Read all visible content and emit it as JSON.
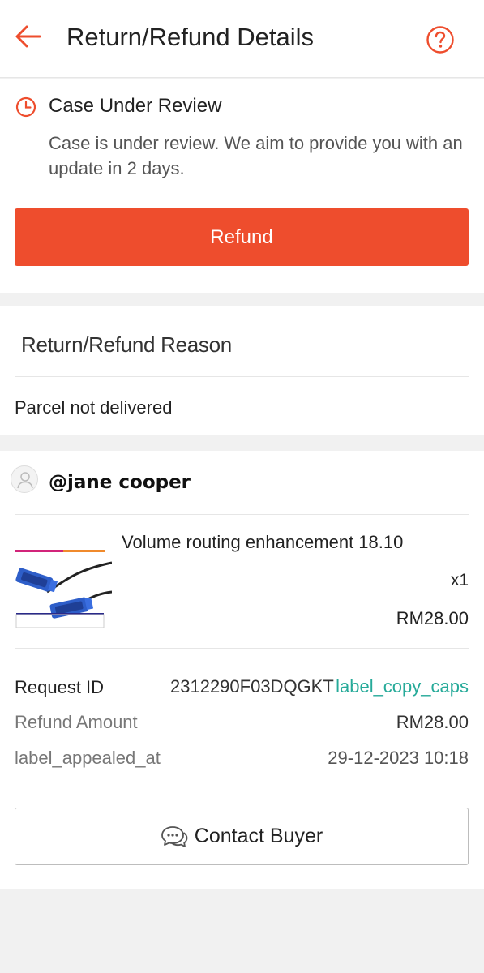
{
  "header": {
    "title": "Return/Refund Details",
    "back_icon": "arrow-left-icon",
    "help_icon": "question-circle-icon"
  },
  "status": {
    "icon": "clock-icon",
    "title": "Case Under Review",
    "description": "Case is under review. We aim to provide you with an update in 2 days.",
    "refund_button_label": "Refund"
  },
  "reason": {
    "title": "Return/Refund Reason",
    "value": "Parcel not delivered"
  },
  "seller": {
    "avatar_icon": "user-avatar-icon",
    "name": "@jane cooper"
  },
  "product": {
    "name": "Volume routing enhancement 18.10",
    "quantity": "x1",
    "price": "RM28.00"
  },
  "info": {
    "request_id_label": "Request ID",
    "request_id_value": "2312290F03DQGKT",
    "copy_label": "label_copy_caps",
    "refund_amount_label": "Refund Amount",
    "refund_amount_value": "RM28.00",
    "appealed_at_label": "label_appealed_at",
    "appealed_at_value": "29-12-2023 10:18"
  },
  "actions": {
    "contact_buyer_label": "Contact Buyer",
    "contact_icon": "chat-bubbles-icon"
  },
  "colors": {
    "accent": "#ee4d2d",
    "link": "#26aa99"
  }
}
